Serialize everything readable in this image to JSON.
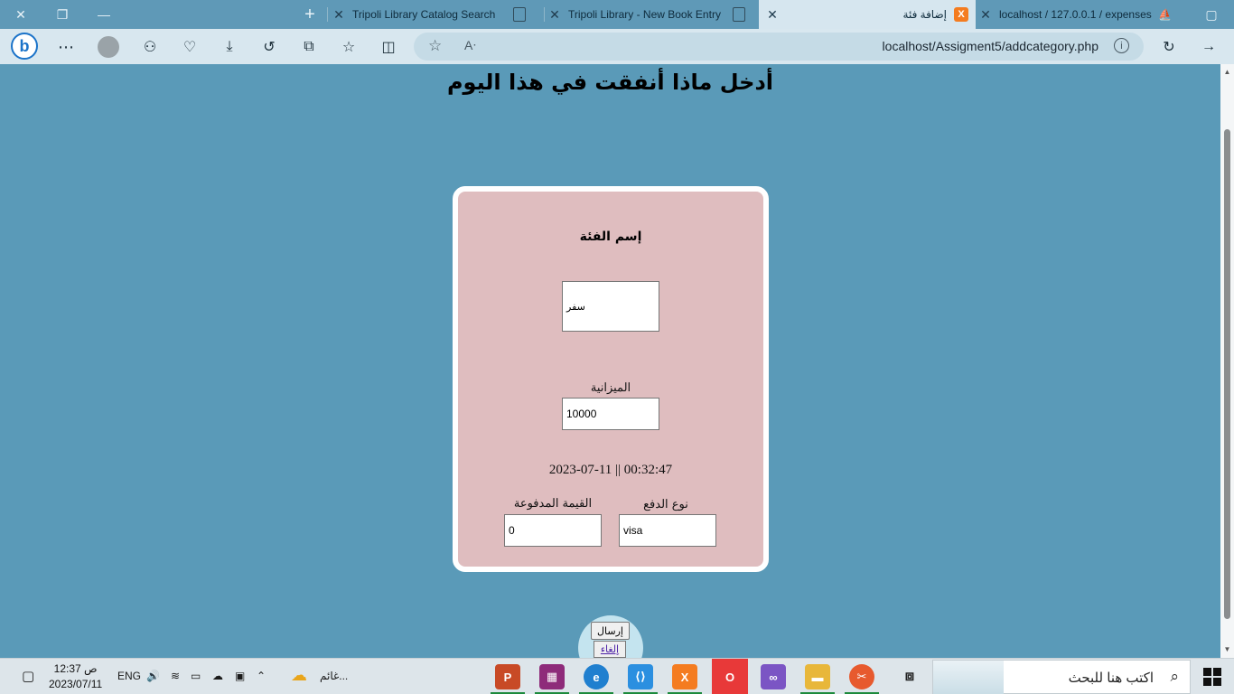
{
  "tabs": [
    {
      "label": "Tripoli Library Catalog Search"
    },
    {
      "label": "Tripoli Library - New Book Entry"
    },
    {
      "label": "إضافة فئة"
    },
    {
      "label": "localhost / 127.0.0.1 / expenses"
    }
  ],
  "address_bar": {
    "url": "localhost/Assigment5/addcategory.php"
  },
  "page": {
    "title": "أدخل ماذا أنفقت في هذا اليوم",
    "category_label": "إسم الفئة",
    "category_value": "سفر",
    "budget_label": "الميزانية",
    "budget_value": "10000",
    "datetime": "2023-07-11 || 00:32:47",
    "paid_label": "القيمة المدفوعة",
    "paid_value": "0",
    "payment_type_label": "نوع الدفع",
    "payment_type_value": "visa",
    "submit_label": "إرسال",
    "cancel_label": "إلغاء"
  },
  "taskbar": {
    "time": "12:37 ص",
    "date": "2023/07/11",
    "language": "ENG",
    "weather": "غائم...",
    "search_placeholder": "اكتب هنا للبحث"
  },
  "colors": {
    "page_bg": "#5a9ab8",
    "card_bg": "#dfbdbf"
  }
}
